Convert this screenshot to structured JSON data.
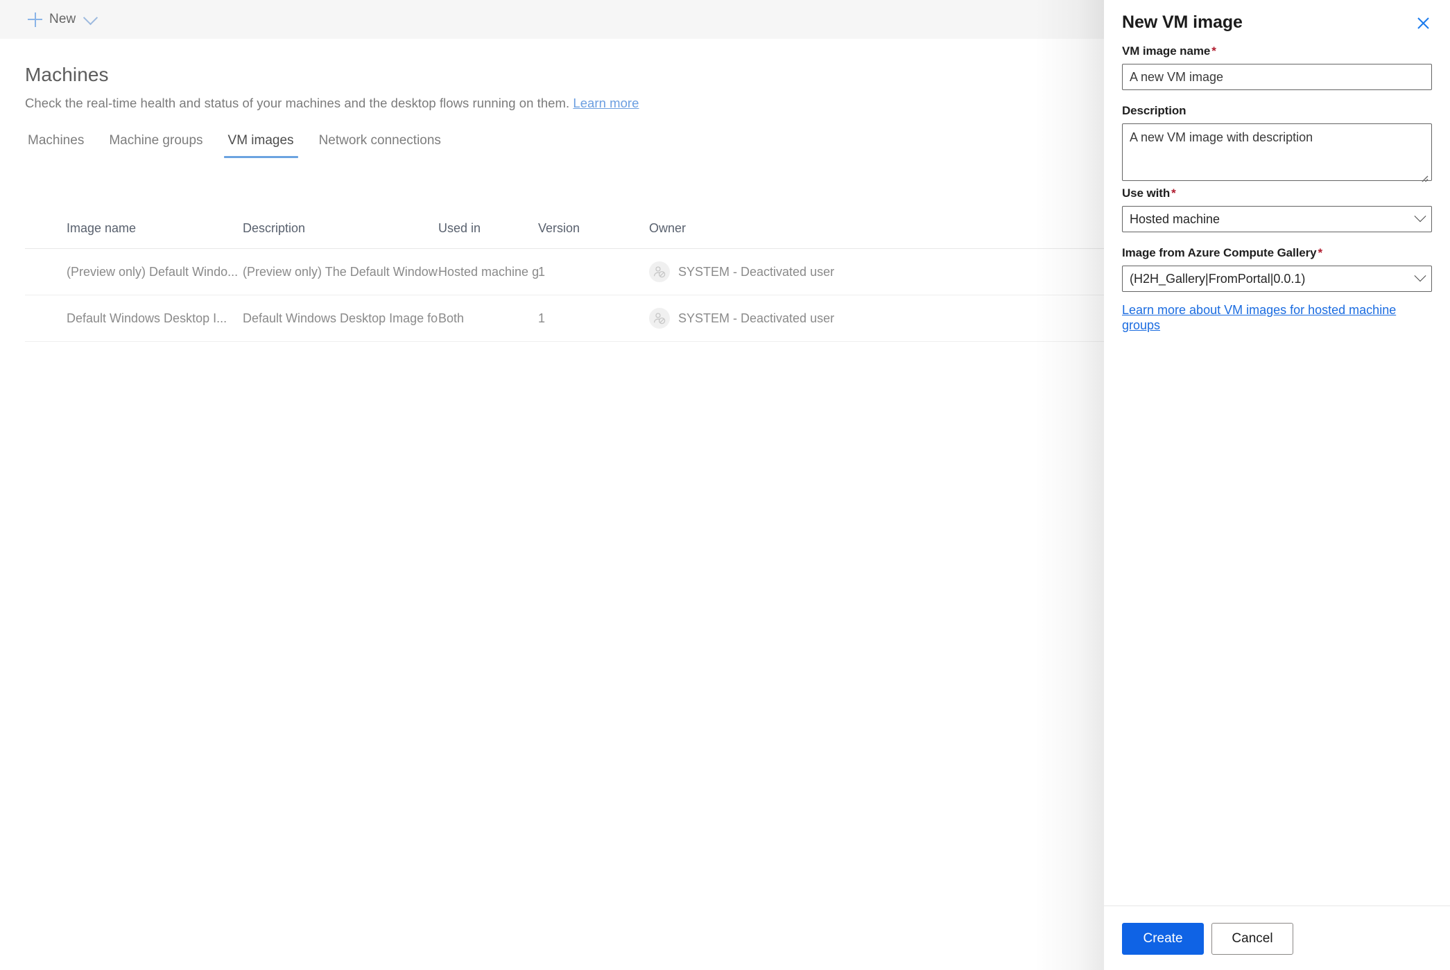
{
  "command_bar": {
    "new_label": "New",
    "plus_icon": "plus-icon",
    "chevron_icon": "chevron-down-icon"
  },
  "page": {
    "title": "Machines",
    "subtitle": "Check the real-time health and status of your machines and the desktop flows running on them.",
    "learn_more": "Learn more"
  },
  "tabs": [
    {
      "label": "Machines",
      "active": false
    },
    {
      "label": "Machine groups",
      "active": false
    },
    {
      "label": "VM images",
      "active": true
    },
    {
      "label": "Network connections",
      "active": false
    }
  ],
  "table": {
    "columns": [
      "Image name",
      "Description",
      "Used in",
      "Version",
      "Owner"
    ],
    "rows": [
      {
        "image_name": "(Preview only) Default Windo...",
        "description": "(Preview only) The Default Windows Desk...",
        "used_in": "Hosted machine group",
        "version": "1",
        "owner": "SYSTEM - Deactivated user",
        "owner_icon": "deactivated-user-icon"
      },
      {
        "image_name": "Default Windows Desktop I...",
        "description": "Default Windows Desktop Image for use i...",
        "used_in": "Both",
        "version": "1",
        "owner": "SYSTEM - Deactivated user",
        "owner_icon": "deactivated-user-icon"
      }
    ]
  },
  "panel": {
    "title": "New VM image",
    "close_icon": "close-icon",
    "fields": {
      "vm_image_name": {
        "label": "VM image name",
        "required_marker": "*",
        "value": "A new VM image"
      },
      "description": {
        "label": "Description",
        "value": "A new VM image with description"
      },
      "use_with": {
        "label": "Use with",
        "required_marker": "*",
        "value": "Hosted machine",
        "chevron_icon": "chevron-down-icon"
      },
      "gallery_image": {
        "label": "Image from Azure Compute Gallery",
        "required_marker": "*",
        "value": "(H2H_Gallery|FromPortal|0.0.1)",
        "chevron_icon": "chevron-down-icon"
      }
    },
    "help_link": "Learn more about VM images for hosted machine groups",
    "buttons": {
      "create": "Create",
      "cancel": "Cancel"
    }
  },
  "colors": {
    "accent_blue": "#0f63e5",
    "link_blue": "#1b6ce0",
    "tab_underline": "#6ba3e0",
    "required_red": "#b01b2e",
    "toolbar_bg": "#f6f6f6"
  }
}
